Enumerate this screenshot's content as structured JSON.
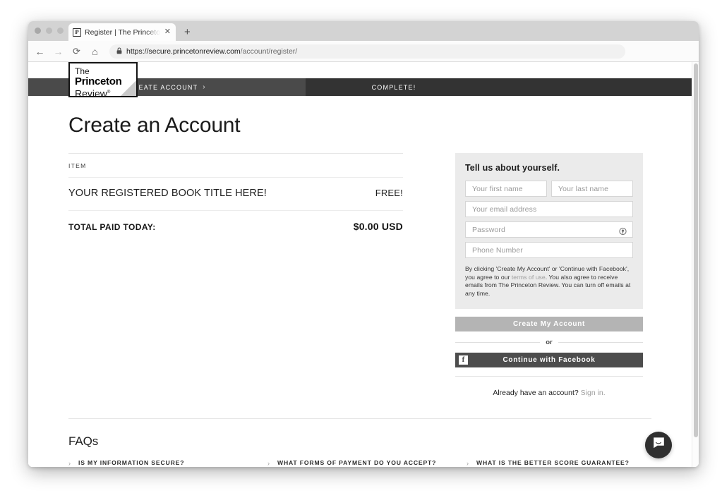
{
  "browser": {
    "tab": {
      "favicon_letter": "P",
      "title": "Register | The Princeton Revie",
      "close_label": "✕"
    },
    "new_tab_label": "+",
    "nav": {
      "back": "←",
      "forward": "→",
      "reload": "⟳",
      "home": "⌂"
    },
    "url": {
      "scheme_host": "https://secure.princetonreview.com",
      "path": "/account/register/"
    }
  },
  "site": {
    "logo": {
      "line1": "The",
      "line2": "Princeton",
      "line3": "Review",
      "trademark": "®"
    },
    "progress": {
      "steps": [
        {
          "label": "CREATE ACCOUNT",
          "chevron": "›",
          "active": true
        },
        {
          "label": "COMPLETE!",
          "active": false
        }
      ]
    }
  },
  "main": {
    "page_title": "Create an Account",
    "order": {
      "column_header": "ITEM",
      "items": [
        {
          "name": "YOUR REGISTERED BOOK TITLE HERE!",
          "price": "FREE!"
        }
      ],
      "total_label": "TOTAL PAID TODAY:",
      "total_value": "$0.00 USD"
    },
    "signup": {
      "heading": "Tell us about yourself.",
      "fields": {
        "first_name_placeholder": "Your first name",
        "last_name_placeholder": "Your last name",
        "email_placeholder": "Your email address",
        "password_placeholder": "Password",
        "phone_placeholder": "Phone Number"
      },
      "terms_part1": "By clicking 'Create My Account' or 'Continue with Facebook', you agree to our ",
      "terms_link": "terms of use",
      "terms_part2": ". You also agree to receive emails from The Princeton Review. You can turn off emails at any time.",
      "submit_label": "Create My Account",
      "or_label": "or",
      "facebook_label": "Continue with Facebook",
      "facebook_mark": "f",
      "signin_prompt": "Already have an account? ",
      "signin_link": "Sign in."
    }
  },
  "faq": {
    "title": "FAQs",
    "items": [
      {
        "chevron": "›",
        "question": "IS MY INFORMATION SECURE?"
      },
      {
        "chevron": "›",
        "question": "WHAT FORMS OF PAYMENT DO YOU ACCEPT?"
      },
      {
        "chevron": "›",
        "question": "WHAT IS THE BETTER SCORE GUARANTEE?"
      }
    ]
  },
  "colors": {
    "nav_active": "#4a4a4a",
    "nav_inactive": "#333333",
    "panel_bg": "#ebebeb",
    "cta_disabled": "#b4b4b4",
    "facebook_btn": "#4d4d4d",
    "chat_widget": "#2f2f2f"
  }
}
